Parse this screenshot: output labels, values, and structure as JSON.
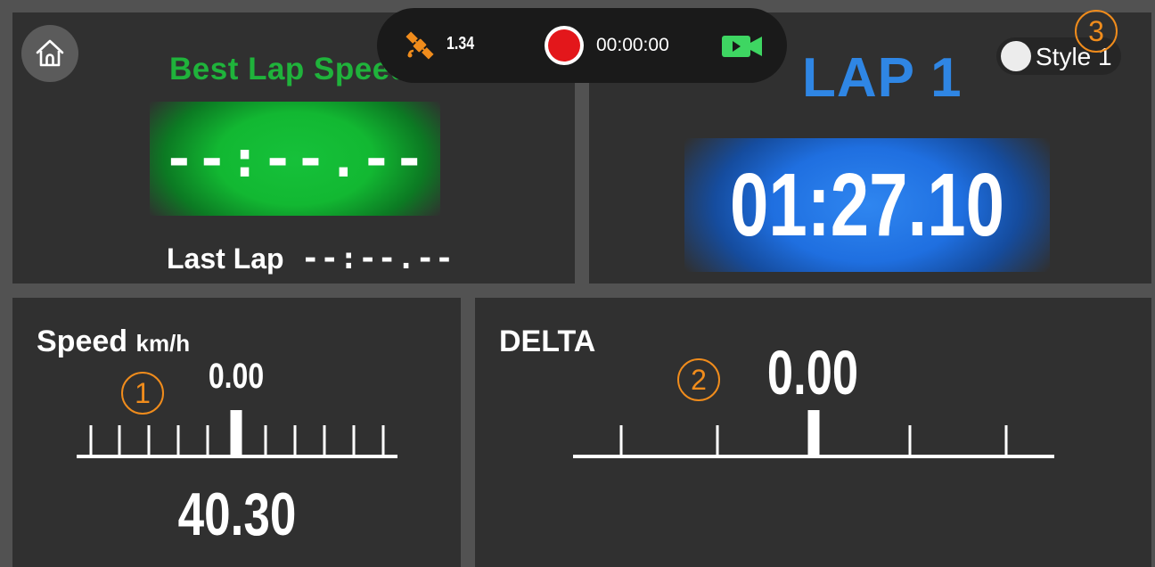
{
  "toolbar": {
    "signal_value": "1.34",
    "record_time": "00:00:00",
    "icons": [
      "satellite-icon",
      "record-icon",
      "video-camera-icon"
    ],
    "colors": {
      "satellite": "#f08c1c",
      "record": "#e3171b",
      "video": "#3ed662"
    }
  },
  "home": {
    "icon": "home-icon"
  },
  "best_lap": {
    "title": "Best Lap Speed",
    "value": "--:--.--",
    "last_lap_label": "Last Lap",
    "last_lap_value": "--:--.--",
    "color": "#1fb33b"
  },
  "lap": {
    "title": "LAP 1",
    "time": "01:27.10",
    "color": "#2f86e4"
  },
  "style_toggle": {
    "label": "Style 1",
    "on": false
  },
  "speed": {
    "title": "Speed",
    "unit": "km/h",
    "scale_reading": "0.00",
    "value": "40.30"
  },
  "delta": {
    "title": "DELTA",
    "value": "0.00"
  },
  "callouts": [
    "1",
    "2",
    "3"
  ]
}
